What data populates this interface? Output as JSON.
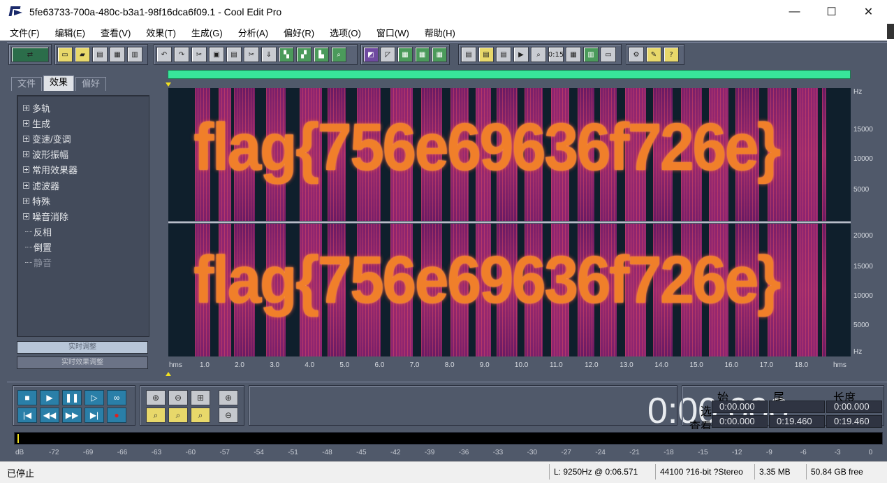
{
  "window": {
    "title": "5fe63733-700a-480c-b3a1-98f16dca6f09.1 - Cool Edit Pro",
    "minimize": "—",
    "maximize": "☐",
    "close": "✕"
  },
  "menu": [
    "文件(F)",
    "编辑(E)",
    "查看(V)",
    "效果(T)",
    "生成(G)",
    "分析(A)",
    "偏好(R)",
    "选项(O)",
    "窗口(W)",
    "帮助(H)"
  ],
  "left_panel": {
    "tabs": [
      "文件",
      "效果",
      "偏好"
    ],
    "active_tab": "效果",
    "tree": [
      {
        "label": "多轨",
        "expandable": true
      },
      {
        "label": "生成",
        "expandable": true
      },
      {
        "label": "变速/变调",
        "expandable": true
      },
      {
        "label": "波形振幅",
        "expandable": true
      },
      {
        "label": "常用效果器",
        "expandable": true
      },
      {
        "label": "滤波器",
        "expandable": true
      },
      {
        "label": "特殊",
        "expandable": true
      },
      {
        "label": "噪音消除",
        "expandable": true
      },
      {
        "label": "反相",
        "expandable": false
      },
      {
        "label": "倒置",
        "expandable": false
      },
      {
        "label": "静音",
        "expandable": false,
        "disabled": true
      }
    ],
    "button1": "实时调整",
    "button2": "实时效果调整"
  },
  "spectrogram": {
    "text": "flag{756e69636f726e}",
    "channel1_freq_labels": [
      "Hz",
      "15000",
      "10000",
      "5000"
    ],
    "channel2_freq_labels": [
      "20000",
      "15000",
      "10000",
      "5000",
      "Hz"
    ],
    "time_labels": [
      "hms",
      "1.0",
      "2.0",
      "3.0",
      "4.0",
      "5.0",
      "6.0",
      "7.0",
      "8.0",
      "9.0",
      "10.0",
      "11.0",
      "12.0",
      "13.0",
      "14.0",
      "15.0",
      "16.0",
      "17.0",
      "18.0",
      "hms"
    ]
  },
  "transport": {
    "time_display": "0:00.000",
    "headers": {
      "start": "始",
      "end": "尾",
      "length": "长度"
    },
    "rows": {
      "select_label": "选",
      "view_label": "查看",
      "select": {
        "start": "0:00.000",
        "end": "",
        "length": "0:00.000"
      },
      "view": {
        "start": "0:00.000",
        "end": "0:19.460",
        "length": "0:19.460"
      }
    }
  },
  "meter_scale": [
    "dB",
    "-72",
    "-69",
    "-66",
    "-63",
    "-60",
    "-57",
    "-54",
    "-51",
    "-48",
    "-45",
    "-42",
    "-39",
    "-36",
    "-33",
    "-30",
    "-27",
    "-24",
    "-21",
    "-18",
    "-15",
    "-12",
    "-9",
    "-6",
    "-3",
    "0"
  ],
  "status": {
    "state": "已停止",
    "cursor": "L: 9250Hz @  0:06.571",
    "format": "44100 ?16-bit ?Stereo",
    "size": "3.35 MB",
    "free": "50.84 GB free"
  }
}
